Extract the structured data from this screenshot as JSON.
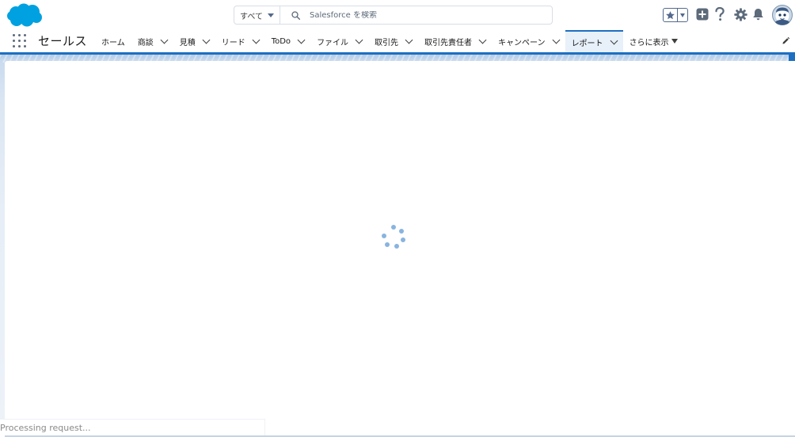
{
  "header": {
    "search_scope": "すべて",
    "search_placeholder": "Salesforce を検索",
    "icons": [
      "star-icon",
      "add-icon",
      "help-icon",
      "gear-icon",
      "bell-icon",
      "avatar"
    ]
  },
  "nav": {
    "app_name": "セールス",
    "tabs": [
      {
        "label": "ホーム",
        "chevron": false
      },
      {
        "label": "商談",
        "chevron": true
      },
      {
        "label": "見積",
        "chevron": true
      },
      {
        "label": "リード",
        "chevron": true
      },
      {
        "label": "ToDo",
        "chevron": true
      },
      {
        "label": "ファイル",
        "chevron": true
      },
      {
        "label": "取引先",
        "chevron": true
      },
      {
        "label": "取引先責任者",
        "chevron": true
      },
      {
        "label": "キャンペーン",
        "chevron": true
      },
      {
        "label": "レポート",
        "chevron": true,
        "active": true
      }
    ],
    "more_label": "さらに表示"
  },
  "status": {
    "text": "Processing request..."
  },
  "colors": {
    "brand": "#00a1e0",
    "accent": "#1d6fc1",
    "icon_gray": "#5c6a7a",
    "spinner": "#88b4df"
  }
}
